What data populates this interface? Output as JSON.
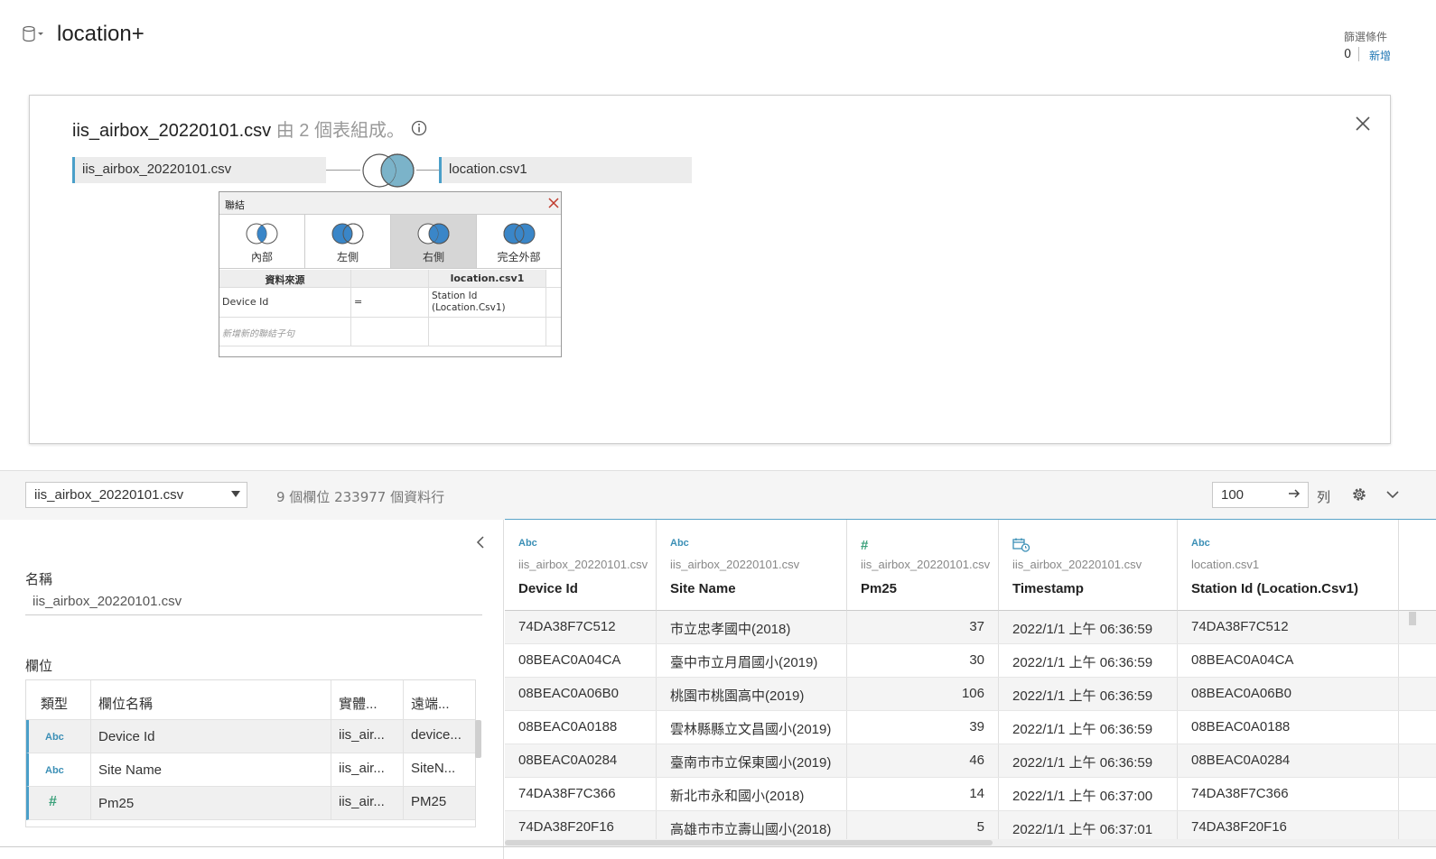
{
  "header": {
    "title": "location+",
    "filters_label": "篩選條件",
    "filters_count": "0",
    "filters_add": "新增"
  },
  "canvas": {
    "title_main": "iis_airbox_20220101.csv",
    "title_sub": " 由 2 個表組成。",
    "left_table": "iis_airbox_20220101.csv",
    "right_table": "location.csv1"
  },
  "join_dialog": {
    "title": "聯結",
    "types": [
      {
        "label": "內部",
        "selected": false
      },
      {
        "label": "左側",
        "selected": false
      },
      {
        "label": "右側",
        "selected": true
      },
      {
        "label": "完全外部",
        "selected": false
      }
    ],
    "col_left": "資料來源",
    "col_right": "location.csv1",
    "clause_left": "Device Id",
    "clause_op": "=",
    "clause_right": "Station Id (Location.Csv1)",
    "add_clause": "新增新的聯結子句"
  },
  "toolbar": {
    "selected_table": "iis_airbox_20220101.csv",
    "summary": "9 個欄位 233977 個資料行",
    "rows_value": "100",
    "rows_unit": "列"
  },
  "left_pane": {
    "name_label": "名稱",
    "name_value": "iis_airbox_20220101.csv",
    "fields_label": "欄位",
    "headers": [
      "類型",
      "欄位名稱",
      "實體...",
      "遠端..."
    ],
    "rows": [
      {
        "type": "Abc",
        "name": "Device Id",
        "physical": "iis_air...",
        "remote": "device..."
      },
      {
        "type": "Abc",
        "name": "Site Name",
        "physical": "iis_air...",
        "remote": "SiteN..."
      },
      {
        "type": "#",
        "name": "Pm25",
        "physical": "iis_air...",
        "remote": "PM25"
      }
    ]
  },
  "grid": {
    "columns": [
      {
        "type": "Abc",
        "source": "iis_airbox_20220101.csv",
        "name": "Device Id"
      },
      {
        "type": "Abc",
        "source": "iis_airbox_20220101.csv",
        "name": "Site Name"
      },
      {
        "type": "#",
        "source": "iis_airbox_20220101.csv",
        "name": "Pm25"
      },
      {
        "type": "datetime",
        "source": "iis_airbox_20220101.csv",
        "name": "Timestamp"
      },
      {
        "type": "Abc",
        "source": "location.csv1",
        "name": "Station Id (Location.Csv1)"
      }
    ],
    "rows": [
      [
        "74DA38F7C512",
        "市立忠孝國中(2018)",
        "37",
        "2022/1/1 上午 06:36:59",
        "74DA38F7C512"
      ],
      [
        "08BEAC0A04CA",
        "臺中市立月眉國小(2019)",
        "30",
        "2022/1/1 上午 06:36:59",
        "08BEAC0A04CA"
      ],
      [
        "08BEAC0A06B0",
        "桃園市桃園高中(2019)",
        "106",
        "2022/1/1 上午 06:36:59",
        "08BEAC0A06B0"
      ],
      [
        "08BEAC0A0188",
        "雲林縣縣立文昌國小(2019)",
        "39",
        "2022/1/1 上午 06:36:59",
        "08BEAC0A0188"
      ],
      [
        "08BEAC0A0284",
        "臺南市市立保東國小(2019)",
        "46",
        "2022/1/1 上午 06:36:59",
        "08BEAC0A0284"
      ],
      [
        "74DA38F7C366",
        "新北市永和國小(2018)",
        "14",
        "2022/1/1 上午 06:37:00",
        "74DA38F7C366"
      ],
      [
        "74DA38F20F16",
        "高雄市市立壽山國小(2018)",
        "5",
        "2022/1/1 上午 06:37:01",
        "74DA38F20F16"
      ]
    ]
  },
  "colors": {
    "accent": "#4a9fc9",
    "venn_fill": "#3a86c8",
    "number_type": "#3aa07a"
  },
  "icons": [
    "database-icon",
    "info-icon",
    "close-icon",
    "venn-icon",
    "dropdown-arrow-icon",
    "go-arrow-icon",
    "gear-icon",
    "chevron-down-icon",
    "chevron-left-icon",
    "calendar-clock-icon"
  ]
}
